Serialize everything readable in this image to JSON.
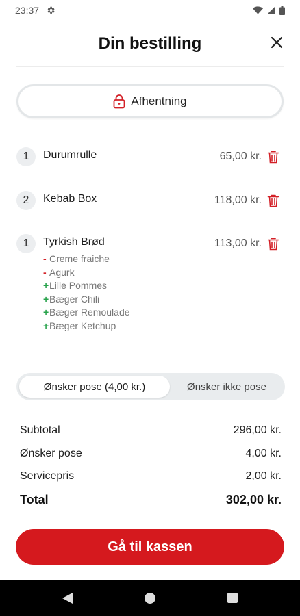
{
  "status_bar": {
    "time": "23:37"
  },
  "header": {
    "title": "Din bestilling"
  },
  "pickup": {
    "label": "Afhentning"
  },
  "items": [
    {
      "qty": "1",
      "name": "Durumrulle",
      "price": "65,00 kr.",
      "modifiers": []
    },
    {
      "qty": "2",
      "name": "Kebab Box",
      "price": "118,00 kr.",
      "modifiers": []
    },
    {
      "qty": "1",
      "name": "Tyrkish Brød",
      "price": "113,00 kr.",
      "modifiers": [
        {
          "sign": "-",
          "text": "Creme fraiche"
        },
        {
          "sign": "-",
          "text": "Agurk"
        },
        {
          "sign": "+",
          "text": "Lille Pommes"
        },
        {
          "sign": "+",
          "text": "Bæger Chili"
        },
        {
          "sign": "+",
          "text": "Bæger Remoulade"
        },
        {
          "sign": "+",
          "text": "Bæger Ketchup"
        }
      ]
    }
  ],
  "bag_toggle": {
    "option_yes": "Ønsker pose (4,00 kr.)",
    "option_no": "Ønsker ikke pose",
    "selected": "yes"
  },
  "summary": {
    "subtotal_label": "Subtotal",
    "subtotal_value": "296,00 kr.",
    "bag_label": "Ønsker pose",
    "bag_value": "4,00 kr.",
    "service_label": "Servicepris",
    "service_value": "2,00 kr.",
    "total_label": "Total",
    "total_value": "302,00 kr."
  },
  "checkout": {
    "label": "Gå til kassen"
  },
  "colors": {
    "accent": "#d5191e",
    "plus": "#27a24b",
    "minus": "#d32027"
  },
  "icons": {
    "close": "close-icon",
    "lock": "lock-icon",
    "trash": "trash-icon",
    "settings": "gear-icon",
    "wifi": "wifi-icon",
    "signal": "signal-icon",
    "battery": "battery-icon",
    "back": "back-triangle-icon",
    "home": "home-circle-icon",
    "recents": "recents-square-icon"
  }
}
